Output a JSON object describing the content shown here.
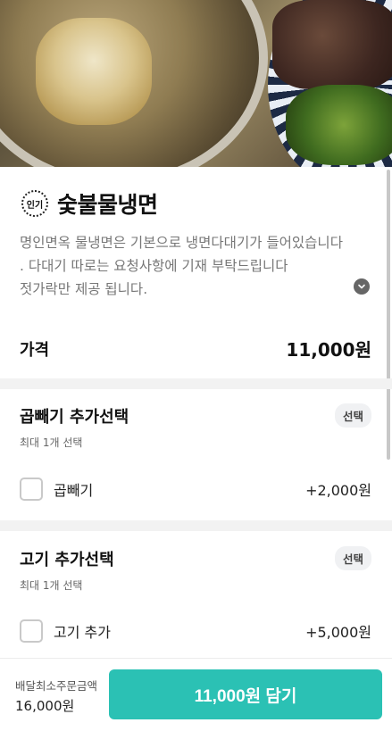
{
  "menu": {
    "badge": "인기",
    "title": "숯불물냉면",
    "description": [
      "명인면옥 물냉면은 기본으로 냉면다대기가 들어있습니다",
      ". 다대기 따로는 요청사항에 기재 부탁드립니다",
      "젓가락만 제공 됩니다."
    ],
    "price_label": "가격",
    "price_value": "11,000원"
  },
  "option_groups": [
    {
      "name": "곱빼기 추가선택",
      "tag": "선택",
      "subtitle": "최대 1개 선택",
      "items": [
        {
          "name": "곱빼기",
          "price": "+2,000원"
        }
      ]
    },
    {
      "name": "고기 추가선택",
      "tag": "선택",
      "subtitle": "최대 1개 선택",
      "items": [
        {
          "name": "고기 추가",
          "price": "+5,000원"
        }
      ]
    }
  ],
  "bottom_bar": {
    "min_order_label": "배달최소주문금액",
    "min_order_value": "16,000원",
    "cta_label": "11,000원 담기"
  },
  "colors": {
    "accent": "#2bc1b4",
    "divider": "#f2f2f2",
    "description_text": "#777777"
  },
  "icons": {
    "badge": "popular-badge-icon",
    "expand": "chevron-down-icon"
  }
}
